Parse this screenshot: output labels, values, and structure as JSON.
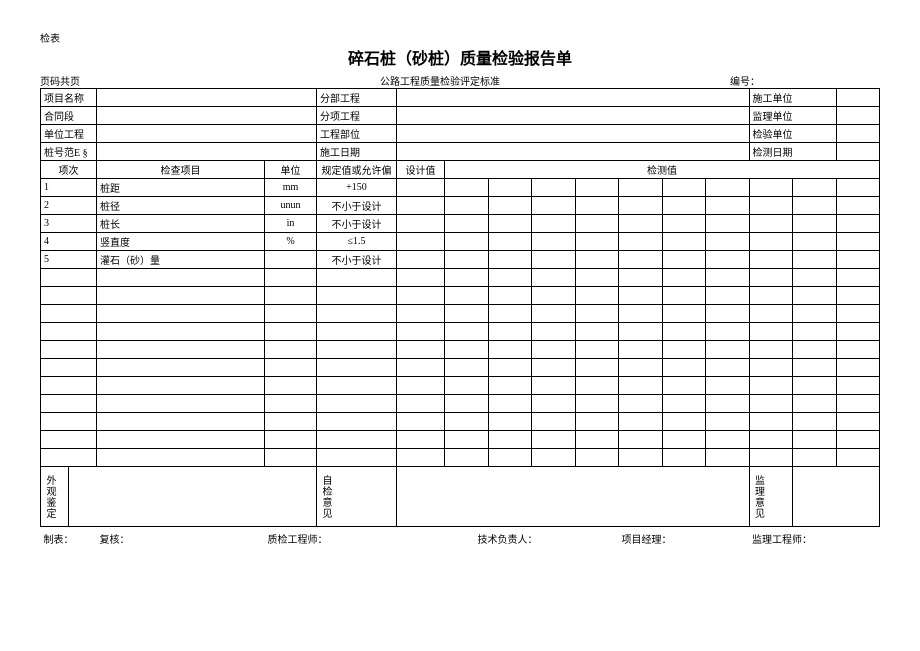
{
  "topleft": "检表",
  "title": "碎石桩（砂桩）质量检验报告单",
  "page_note": "页码共页",
  "standard": "公路工程质量检验评定标准",
  "serial_label": "编号：",
  "header": {
    "project_name_label": "项目名称",
    "sub_project_label": "分部工程",
    "construction_unit_label": "施工单位",
    "contract_segment_label": "合同段",
    "sub_item_label": "分项工程",
    "supervision_unit_label": "监理单位",
    "unit_project_label": "单位工程",
    "project_part_label": "工程部位",
    "inspection_unit_label": "检验单位",
    "pile_range_label": "桩号范E §",
    "construction_date_label": "施工日期",
    "inspection_date_label": "检测日期"
  },
  "table_head": {
    "seq": "项次",
    "item": "检查项目",
    "unit": "单位",
    "tolerance": "规定值或允许偏",
    "design": "设计值",
    "measured": "检测值"
  },
  "rows": [
    {
      "no": "1",
      "item": "桩距",
      "unit": "mm",
      "tol": "+150"
    },
    {
      "no": "2",
      "item": "桩径",
      "unit": "unun",
      "tol": "不小于设计"
    },
    {
      "no": "3",
      "item": "桩长",
      "unit": "in",
      "tol": "不小于设计"
    },
    {
      "no": "4",
      "item": "竖直度",
      "unit": "%",
      "tol": "≤1.5"
    },
    {
      "no": "5",
      "item": "灌石（砂）量",
      "unit": "",
      "tol": "不小于设计"
    }
  ],
  "opinion": {
    "appearance": "外观鉴定",
    "self_check": "自检意见",
    "supervision": "监理意见"
  },
  "footer": {
    "made_by": "制表：",
    "reviewed_by": "复核：",
    "quality_engineer": "质检工程师：",
    "technical_lead": "技术负责人：",
    "project_manager": "项目经理：",
    "supervision_engineer": "监理工程师："
  }
}
